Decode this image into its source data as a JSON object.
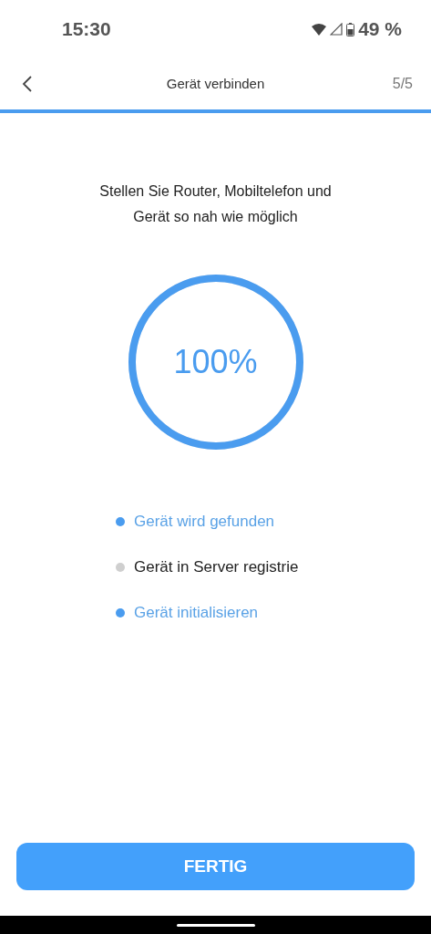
{
  "status_bar": {
    "time": "15:30",
    "battery": "49 %"
  },
  "header": {
    "title": "Gerät verbinden",
    "step": "5/5",
    "level": 1
  },
  "instruction": "Stellen Sie Router, Mobiltelefon und Gerät so nah wie möglich",
  "progress": {
    "label": "100%",
    "level": 1
  },
  "steps": [
    {
      "label": "Gerät wird gefunden",
      "done": true
    },
    {
      "label": "Gerät in Server registrie",
      "done": false
    },
    {
      "label": "Gerät initialisieren",
      "done": true
    }
  ],
  "button": "FERTIG"
}
